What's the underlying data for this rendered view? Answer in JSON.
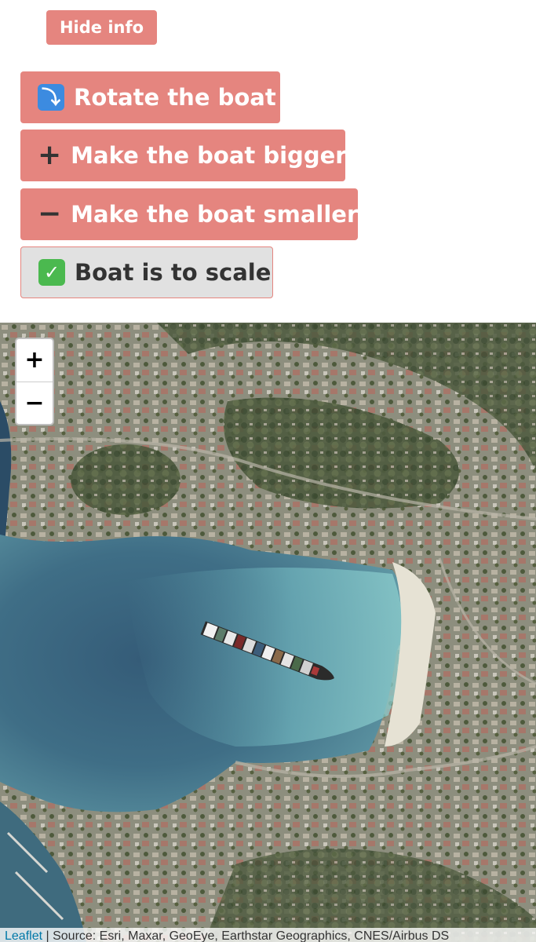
{
  "controls": {
    "hide_info_label": "Hide info",
    "rotate": {
      "icon": "rotate-icon",
      "glyph": "⤵",
      "label": "Rotate the boat"
    },
    "bigger": {
      "icon": "plus-icon",
      "glyph": "+",
      "label": "Make the boat bigger"
    },
    "smaller": {
      "icon": "minus-icon",
      "glyph": "−",
      "label": "Make the boat smaller"
    },
    "scale": {
      "icon": "check-icon",
      "glyph": "✓",
      "label": "Boat is to scale"
    }
  },
  "map": {
    "zoom_in_label": "+",
    "zoom_out_label": "−",
    "attribution_link": "Leaflet",
    "attribution_separator": " | ",
    "attribution_text": "Source: Esri, Maxar, GeoEye, Earthstar Geographics, CNES/Airbus DS"
  },
  "colors": {
    "button": "#e5857f",
    "button_text": "#ffffff",
    "toggle_bg": "#e1e1e1",
    "water_deep": "#2e4f6e",
    "water_shallow": "#7fc0c8",
    "land": "#8a8c78"
  }
}
